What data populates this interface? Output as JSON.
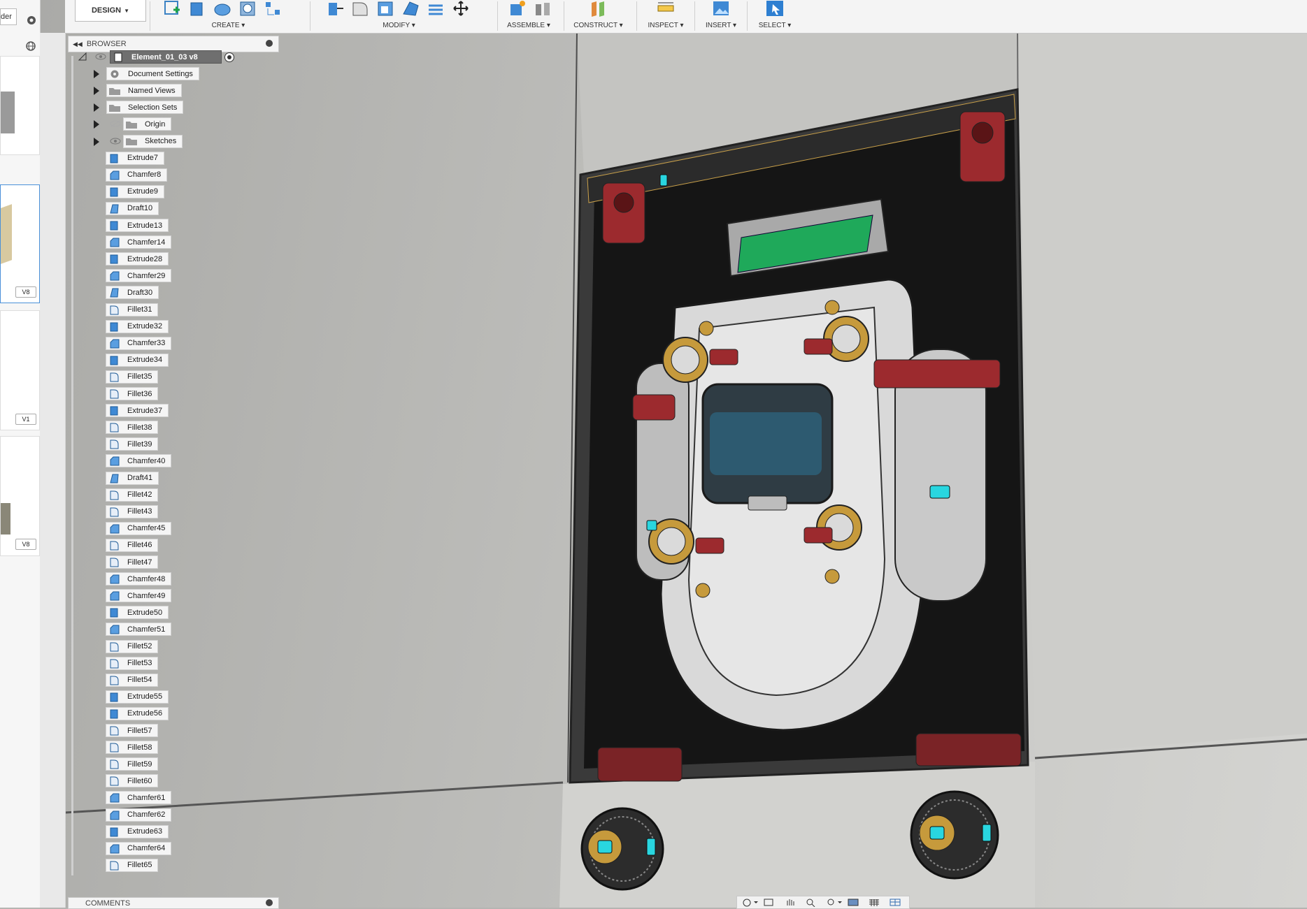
{
  "toolbar": {
    "workspace": "DESIGN",
    "groups": [
      {
        "label": "CREATE"
      },
      {
        "label": "MODIFY"
      },
      {
        "label": "ASSEMBLE"
      },
      {
        "label": "CONSTRUCT"
      },
      {
        "label": "INSPECT"
      },
      {
        "label": "INSERT"
      },
      {
        "label": "SELECT"
      }
    ]
  },
  "left_panel": {
    "partial_label": "der",
    "versions": [
      "V8",
      "V1",
      "V8"
    ]
  },
  "browser": {
    "title": "BROWSER",
    "root": "Element_01_03 v8",
    "folders": [
      {
        "label": "Document Settings",
        "icon": "gear-icon"
      },
      {
        "label": "Named Views",
        "icon": "folder-icon"
      },
      {
        "label": "Selection Sets",
        "icon": "folder-icon"
      },
      {
        "label": "Origin",
        "icon": "folder-icon"
      },
      {
        "label": "Sketches",
        "icon": "folder-icon"
      }
    ],
    "features": [
      "Extrude7",
      "Chamfer8",
      "Extrude9",
      "Draft10",
      "Extrude13",
      "Chamfer14",
      "Extrude28",
      "Chamfer29",
      "Draft30",
      "Fillet31",
      "Extrude32",
      "Chamfer33",
      "Extrude34",
      "Fillet35",
      "Fillet36",
      "Extrude37",
      "Fillet38",
      "Fillet39",
      "Chamfer40",
      "Draft41",
      "Fillet42",
      "Fillet43",
      "Chamfer45",
      "Fillet46",
      "Fillet47",
      "Chamfer48",
      "Chamfer49",
      "Extrude50",
      "Chamfer51",
      "Fillet52",
      "Fillet53",
      "Fillet54",
      "Extrude55",
      "Extrude56",
      "Fillet57",
      "Fillet58",
      "Fillet59",
      "Fillet60",
      "Chamfer61",
      "Chamfer62",
      "Extrude63",
      "Chamfer64",
      "Fillet65"
    ]
  },
  "comments": {
    "title": "COMMENTS"
  },
  "colors": {
    "accent_blue": "#2e7fd1",
    "screen_green": "#1fa95a",
    "indicator_cyan": "#29d6e0",
    "red_bracket": "#9c2a2e",
    "brass": "#c69a3c"
  }
}
